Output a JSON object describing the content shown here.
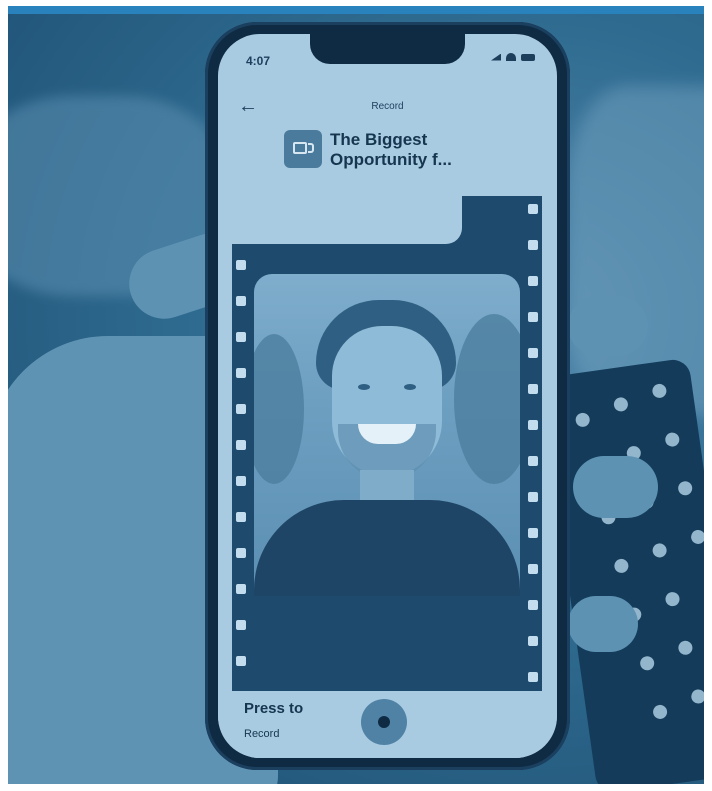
{
  "status_bar": {
    "time": "4:07"
  },
  "header": {
    "title": "Record",
    "back_icon": "arrow-left-icon"
  },
  "item": {
    "title": "The Biggest Opportunity f...",
    "icon": "video-camera-icon"
  },
  "footer": {
    "press_label": "Press to",
    "record_label": "Record",
    "record_icon": "record-dot-icon"
  },
  "colors": {
    "duotone_dark": "#0f2b44",
    "duotone_mid": "#1d4a6d",
    "duotone_light": "#a9cbe2",
    "accent": "#4f82a4"
  }
}
